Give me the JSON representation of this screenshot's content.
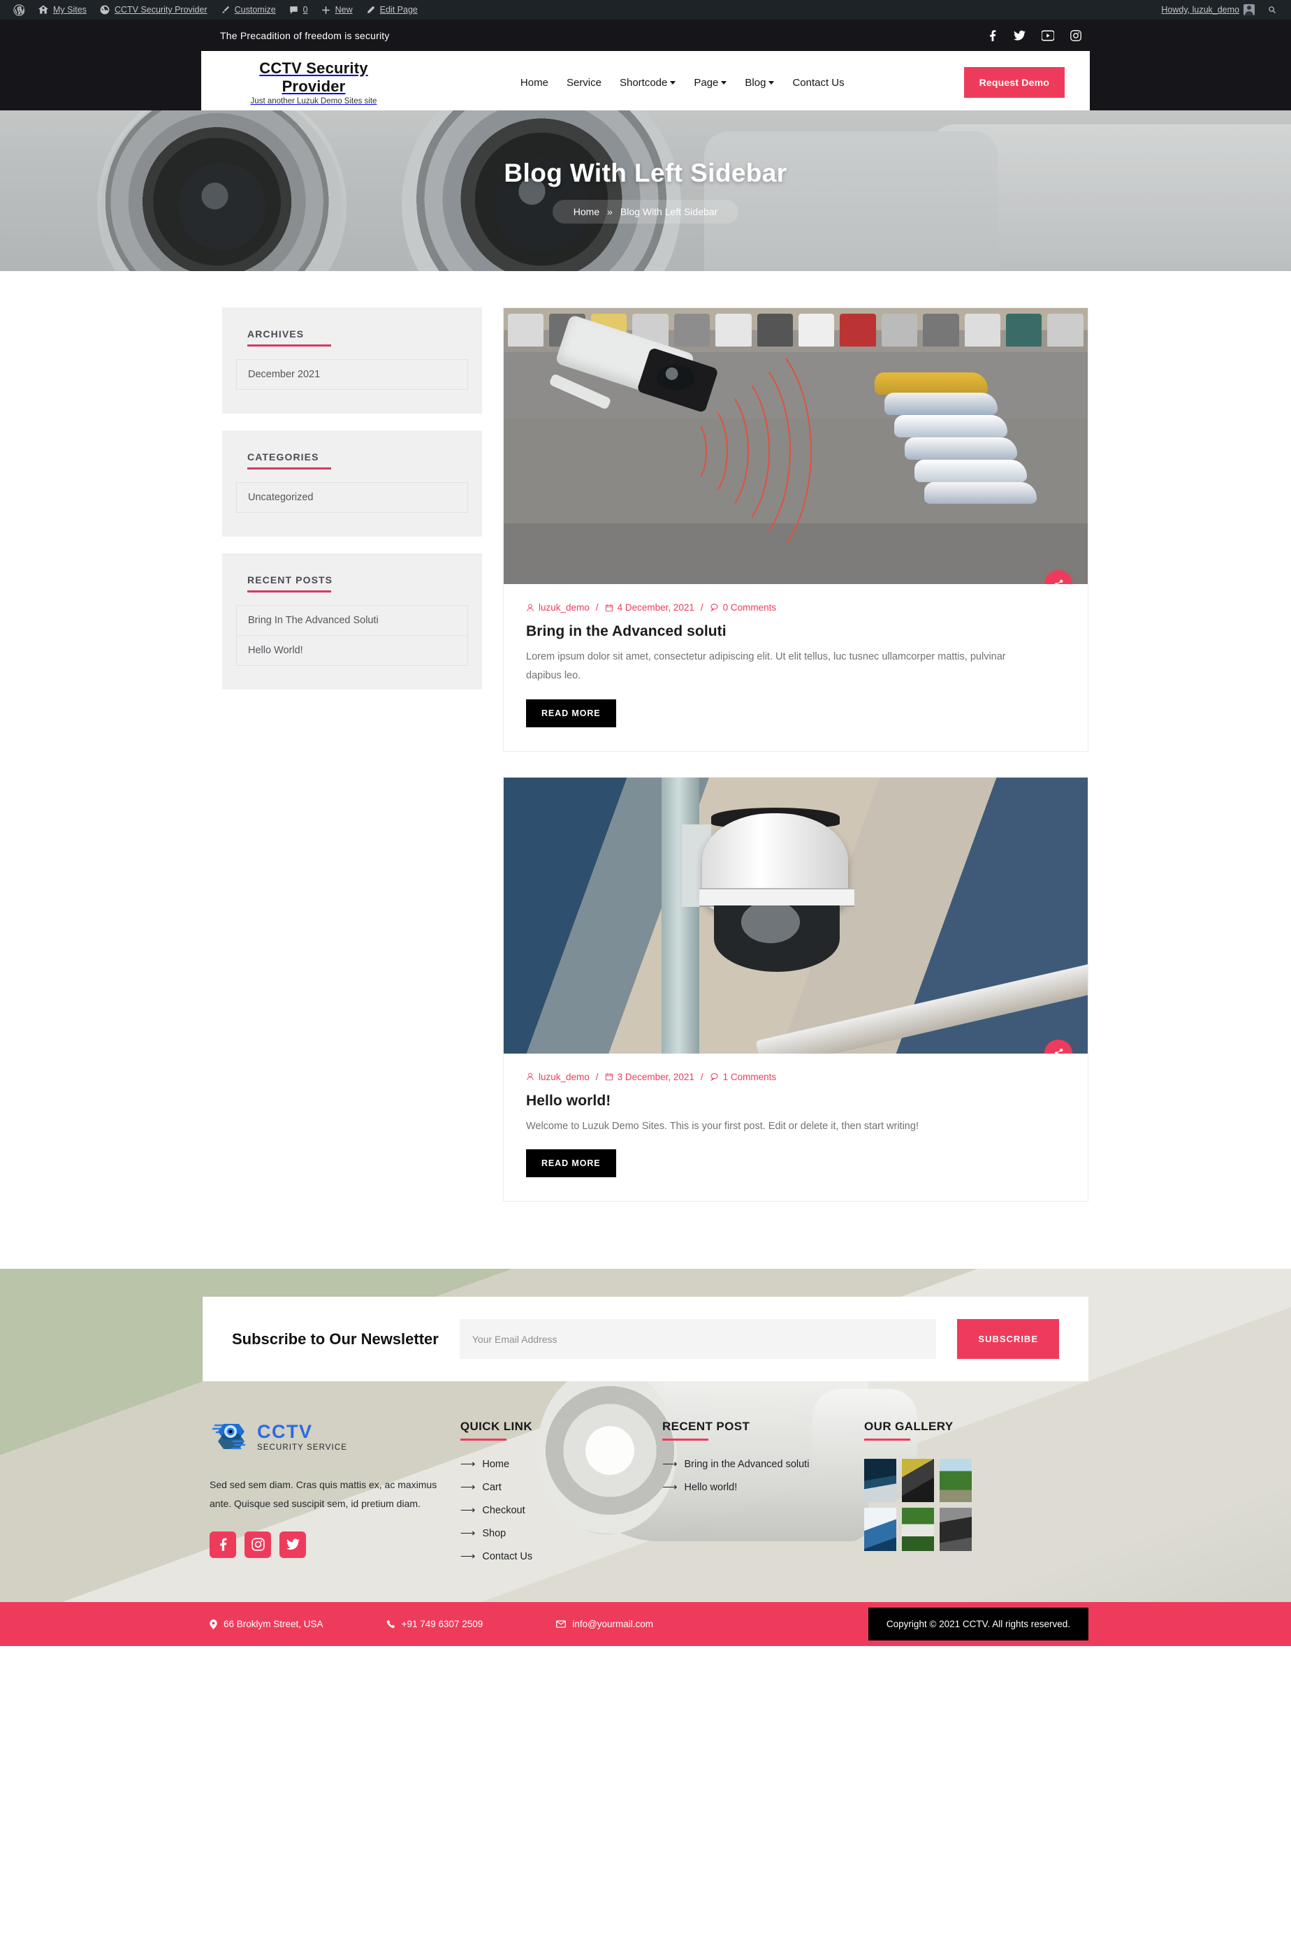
{
  "adminbar": {
    "items": [
      {
        "icon": "wordpress-icon",
        "label": ""
      },
      {
        "icon": "sites-icon",
        "label": "My Sites"
      },
      {
        "icon": "site-icon",
        "label": "CCTV Security Provider"
      },
      {
        "icon": "brush-icon",
        "label": "Customize"
      },
      {
        "icon": "comment-icon",
        "label": "0"
      },
      {
        "icon": "plus-icon",
        "label": "New"
      },
      {
        "icon": "pencil-icon",
        "label": "Edit Page"
      }
    ],
    "howdy": "Howdy, luzuk_demo",
    "search_icon": "search-icon"
  },
  "topbar": {
    "tagline": "The Precadition of freedom is security",
    "socials": [
      {
        "name": "facebook-icon",
        "label": "Facebook"
      },
      {
        "name": "twitter-icon",
        "label": "Twitter"
      },
      {
        "name": "youtube-icon",
        "label": "YouTube"
      },
      {
        "name": "instagram-icon",
        "label": "Instagram"
      }
    ]
  },
  "header": {
    "brand_title": "CCTV Security Provider",
    "brand_subtitle": "Just another Luzuk Demo Sites site",
    "nav": [
      {
        "label": "Home",
        "has_dropdown": false
      },
      {
        "label": "Service",
        "has_dropdown": false
      },
      {
        "label": "Shortcode",
        "has_dropdown": true
      },
      {
        "label": "Page",
        "has_dropdown": true
      },
      {
        "label": "Blog",
        "has_dropdown": true
      },
      {
        "label": "Contact Us",
        "has_dropdown": false
      }
    ],
    "cta_label": "Request Demo"
  },
  "hero": {
    "title": "Blog With Left Sidebar",
    "breadcrumb_home": "Home",
    "breadcrumb_sep": "»",
    "breadcrumb_current": "Blog With Left Sidebar"
  },
  "sidebar": {
    "widgets": [
      {
        "title": "ARCHIVES",
        "items": [
          "December 2021"
        ]
      },
      {
        "title": "CATEGORIES",
        "items": [
          "Uncategorized"
        ]
      },
      {
        "title": "RECENT POSTS",
        "items": [
          "Bring In The Advanced Soluti",
          "Hello World!"
        ]
      }
    ]
  },
  "posts": [
    {
      "author": "luzuk_demo",
      "date": "4 December, 2021",
      "comments": "0 Comments",
      "title": "Bring in the Advanced soluti",
      "excerpt": "Lorem ipsum dolor sit amet, consectetur adipiscing elit. Ut elit tellus, luc tusnec ullamcorper mattis, pulvinar dapibus leo.",
      "read_more": "READ MORE",
      "thumb": "parking-lot-cctv-camera-image",
      "share_icon": "share-icon"
    },
    {
      "author": "luzuk_demo",
      "date": "3 December, 2021",
      "comments": "1 Comments",
      "title": "Hello world!",
      "excerpt": "Welcome to Luzuk Demo Sites. This is your first post. Edit or delete it, then start writing!",
      "read_more": "READ MORE",
      "thumb": "dome-cctv-camera-on-pole-image",
      "share_icon": "share-icon"
    }
  ],
  "newsletter": {
    "heading": "Subscribe to Our Newsletter",
    "placeholder": "Your Email Address",
    "value": "",
    "button": "SUBSCRIBE"
  },
  "footer": {
    "logo_line1": "CCTV",
    "logo_line2": "SECURITY SERVICE",
    "description": "Sed sed sem diam. Cras quis mattis ex, ac maximus ante. Quisque sed suscipit sem, id pretium diam.",
    "socials": [
      {
        "name": "facebook-icon",
        "label": "Facebook"
      },
      {
        "name": "instagram-icon",
        "label": "Instagram"
      },
      {
        "name": "twitter-icon",
        "label": "Twitter"
      }
    ],
    "quick_link": {
      "title": "QUICK LINK",
      "items": [
        "Home",
        "Cart",
        "Checkout",
        "Shop",
        "Contact Us"
      ]
    },
    "recent_post": {
      "title": "RECENT POST",
      "items": [
        "Bring in the Advanced soluti",
        "Hello world!"
      ]
    },
    "gallery": {
      "title": "OUR GALLERY",
      "items": [
        "technician-server-room-image",
        "camera-tools-cables-image",
        "outdoor-driveway-camera-image",
        "security-lock-digital-image",
        "camera-in-garden-image",
        "camera-closeup-hand-image"
      ]
    }
  },
  "bottombar": {
    "address": "66 Broklym Street, USA",
    "phone": "+91 749 6307 2509",
    "email": "info@yourmail.com",
    "copyright": "Copyright © 2021 CCTV. All rights reserved."
  },
  "colors": {
    "accent": "#ef3b5b",
    "dark": "#16161a",
    "widget_underline": "#d23b63",
    "logo_blue": "#2b6be0"
  }
}
